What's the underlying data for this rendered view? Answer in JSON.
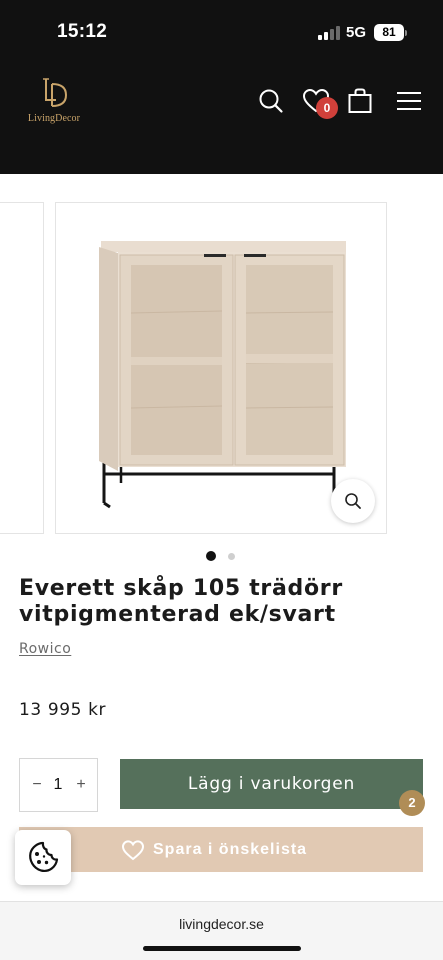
{
  "status_bar": {
    "time": "15:12",
    "network": "5G",
    "battery": "81"
  },
  "header": {
    "logo_text": "LivingDecor",
    "wishlist_count": "0",
    "icons": [
      "search-icon",
      "heart-icon",
      "bag-icon",
      "menu-icon"
    ]
  },
  "gallery": {
    "slide_count": 2,
    "active_slide": 1
  },
  "product": {
    "title": "Everett skåp 105 trädörr vitpigmenterad ek/svart",
    "brand": "Rowico",
    "price": "13 995 kr",
    "quantity": "1",
    "qty_minus": "−",
    "qty_plus": "+",
    "add_to_cart": "Lägg i varukorgen",
    "cart_count": "2",
    "wishlist_label": "Spara i önskelista"
  },
  "browser": {
    "url": "livingdecor.se"
  },
  "colors": {
    "header_bg": "#111111",
    "brand_gold": "#c9a46a",
    "add_button": "#55705b",
    "wishlist_button": "#e1c9b3",
    "badge_red": "#d0403a",
    "cart_badge": "#b08d57"
  }
}
